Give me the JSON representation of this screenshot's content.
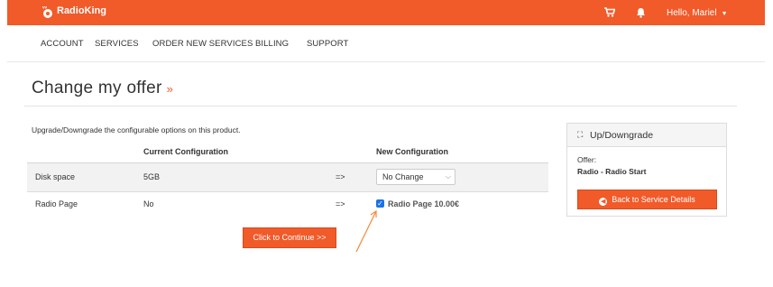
{
  "header": {
    "brand": "RadioKing",
    "user_greeting": "Hello, Mariel",
    "brand_color": "#f15a29"
  },
  "nav": {
    "items": [
      {
        "label": "ACCOUNT"
      },
      {
        "label": "SERVICES"
      },
      {
        "label": "ORDER NEW SERVICES"
      },
      {
        "label": "BILLING"
      },
      {
        "label": "SUPPORT"
      }
    ]
  },
  "page": {
    "title": "Change my offer",
    "title_suffix": "»",
    "intro": "Upgrade/Downgrade the configurable options on this product."
  },
  "table": {
    "headers": {
      "current": "Current Configuration",
      "new": "New Configuration"
    },
    "rows": [
      {
        "option": "Disk space",
        "current": "5GB",
        "arrow": "=>",
        "new_value": "No Change"
      },
      {
        "option": "Radio Page",
        "current": "No",
        "arrow": "=>",
        "new_value": "Radio Page 10.00€",
        "checked": true
      }
    ]
  },
  "actions": {
    "continue_label": "Click to Continue >>"
  },
  "sidebar": {
    "panel_title": "Up/Downgrade",
    "offer_label": "Offer:",
    "offer_value": "Radio - Radio Start",
    "back_label": "Back to Service Details"
  },
  "icons": {
    "cart": "shopping-cart-icon",
    "bell": "bell-icon",
    "caret": "caret-down-icon",
    "expand": "expand-icon",
    "back": "arrow-circle-left-icon",
    "check": "checkmark-icon"
  }
}
